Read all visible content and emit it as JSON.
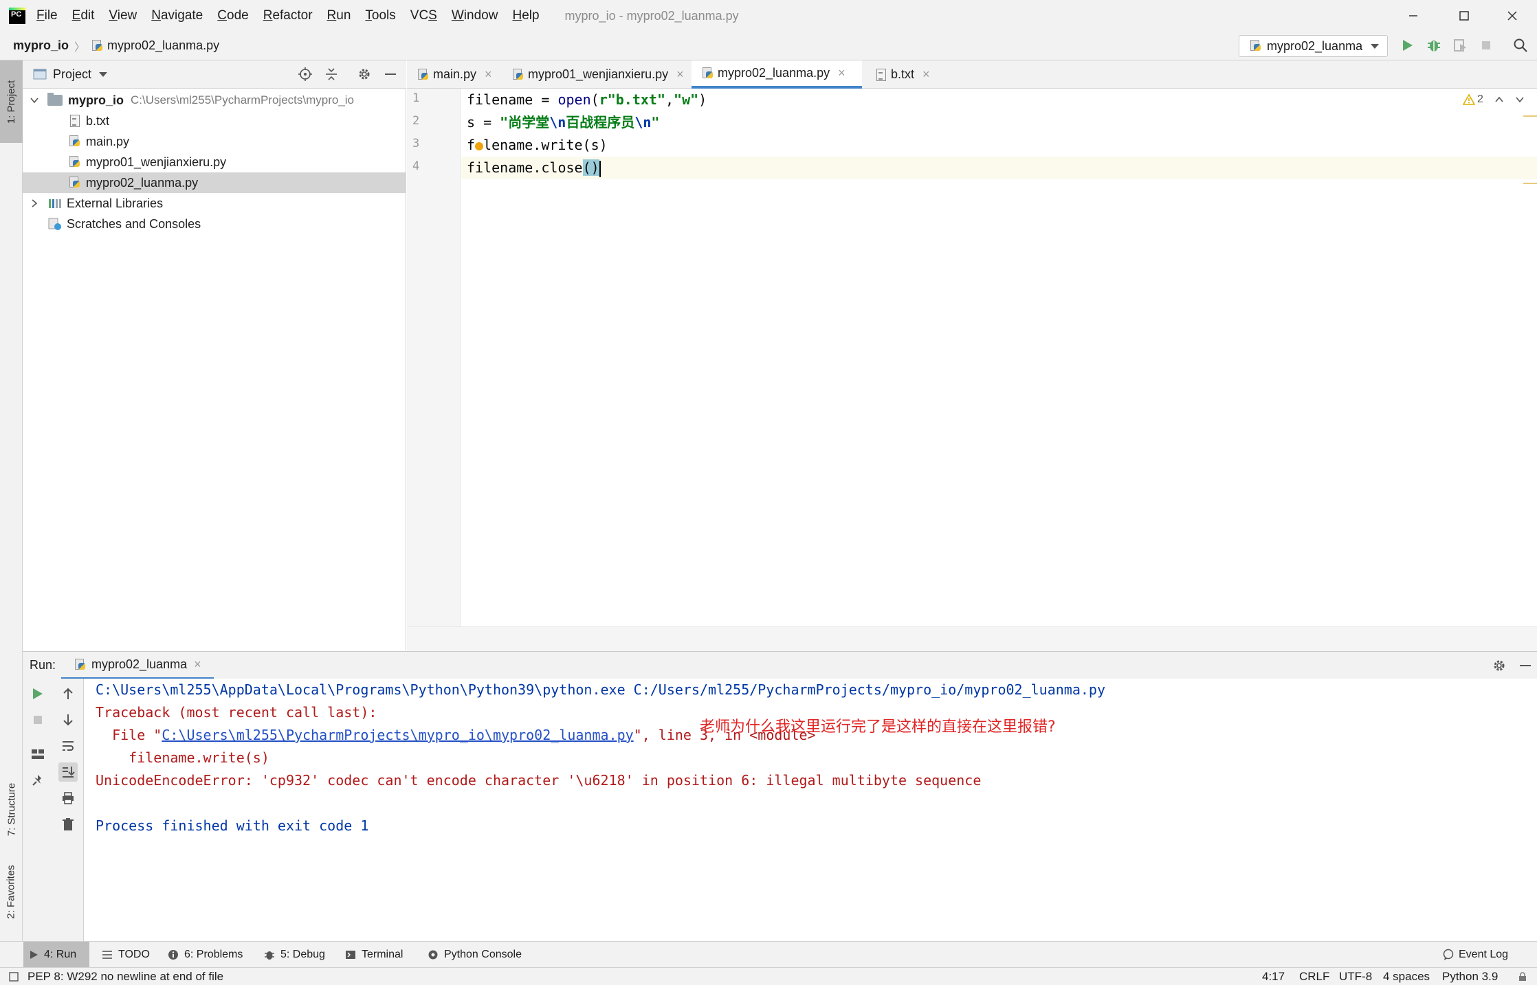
{
  "window": {
    "title": "mypro_io - mypro02_luanma.py",
    "menu": [
      "File",
      "Edit",
      "View",
      "Navigate",
      "Code",
      "Refactor",
      "Run",
      "Tools",
      "VCS",
      "Window",
      "Help"
    ],
    "mnemonics": [
      "F",
      "E",
      "V",
      "N",
      "C",
      "R",
      "R",
      "T",
      "S",
      "W",
      "H"
    ]
  },
  "navbar": {
    "project": "mypro_io",
    "file": "mypro02_luanma.py",
    "run_config": "mypro02_luanma"
  },
  "left_strip": {
    "project": "1: Project",
    "structure": "7: Structure",
    "favorites": "2: Favorites"
  },
  "project_panel": {
    "title": "Project",
    "root_name": "mypro_io",
    "root_path": "C:\\Users\\ml255\\PycharmProjects\\mypro_io",
    "files": [
      "b.txt",
      "main.py",
      "mypro01_wenjianxieru.py",
      "mypro02_luanma.py"
    ],
    "selected_file": "mypro02_luanma.py",
    "external_libraries": "External Libraries",
    "scratches": "Scratches and Consoles"
  },
  "editor": {
    "tabs": [
      "main.py",
      "mypro01_wenjianxieru.py",
      "mypro02_luanma.py",
      "b.txt"
    ],
    "active_tab": "mypro02_luanma.py",
    "line_numbers": [
      "1",
      "2",
      "3",
      "4"
    ],
    "warnings_count": "2",
    "code": {
      "line1_a": "filename = ",
      "line1_open": "open",
      "line1_b": "(",
      "line1_s1": "r\"b.txt\"",
      "line1_c": ",",
      "line1_s2": "\"w\"",
      "line1_d": ")",
      "line2_a": "s = ",
      "line2_q1": "\"",
      "line2_t1": "尚学堂",
      "line2_e1": "\\n",
      "line2_t2": "百战程序员",
      "line2_e2": "\\n",
      "line2_q2": "\"",
      "line3_a": "f",
      "line3_b": "lename.write(s)",
      "line4_a": "filename.close",
      "line4_b": "()"
    }
  },
  "run": {
    "label": "Run:",
    "tab": "mypro02_luanma",
    "output": {
      "cmd": "C:\\Users\\ml255\\AppData\\Local\\Programs\\Python\\Python39\\python.exe C:/Users/ml255/PycharmProjects/mypro_io/mypro02_luanma.py",
      "traceback": "Traceback (most recent call last):",
      "file_prefix": "  File \"",
      "file_link": "C:\\Users\\ml255\\PycharmProjects\\mypro_io\\mypro02_luanma.py",
      "file_suffix": "\", line 3, in <module>",
      "code_line": "    filename.write(s)",
      "error": "UnicodeEncodeError: 'cp932' codec can't encode character '\\u6218' in position 6: illegal multibyte sequence",
      "finished": "Process finished with exit code 1"
    },
    "annotation": "老师为什么我这里运行完了是这样的直接在这里报错?"
  },
  "bottom_tabs": {
    "run": "4: Run",
    "todo": "TODO",
    "problems": "6: Problems",
    "debug": "5: Debug",
    "terminal": "Terminal",
    "python_console": "Python Console",
    "event_log": "Event Log"
  },
  "status": {
    "message": "PEP 8: W292 no newline at end of file",
    "position": "4:17",
    "line_sep": "CRLF",
    "encoding": "UTF-8",
    "indent": "4 spaces",
    "interpreter": "Python 3.9"
  },
  "colors": {
    "accent": "#4083c9",
    "run_green": "#59a869",
    "error_red": "#b11a1a",
    "annotation_red": "#e02424"
  }
}
